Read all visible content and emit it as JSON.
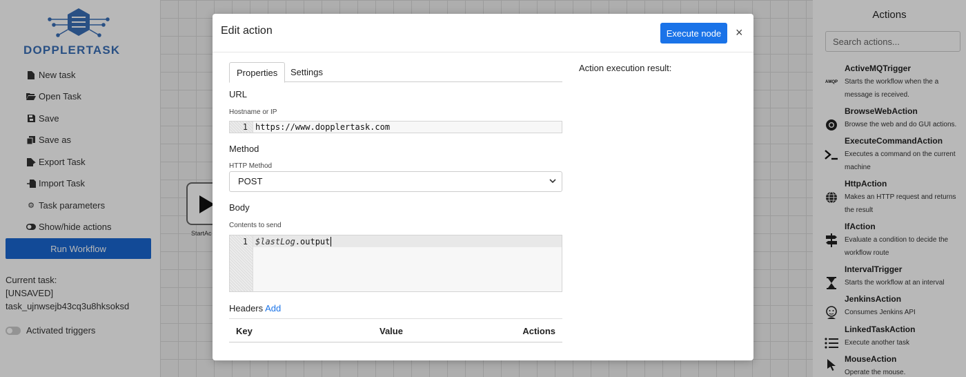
{
  "app": {
    "logo_text": "DOPPLERTASK",
    "accent_color": "#1a73e8"
  },
  "sidebar": {
    "items": [
      {
        "label": "New task",
        "icon": "file-icon"
      },
      {
        "label": "Open Task",
        "icon": "folder-open-icon"
      },
      {
        "label": "Save",
        "icon": "save-icon"
      },
      {
        "label": "Save as",
        "icon": "copy-icon"
      },
      {
        "label": "Export Task",
        "icon": "export-icon"
      },
      {
        "label": "Import Task",
        "icon": "import-icon"
      },
      {
        "label": "Task parameters",
        "icon": "gear-icon"
      },
      {
        "label": "Show/hide actions",
        "icon": "toggle-icon"
      }
    ],
    "run_label": "Run Workflow",
    "current_task": {
      "label": "Current task:",
      "status": "[UNSAVED]",
      "name": "task_ujnwsejb43cq3u8hksoksd"
    },
    "activated_triggers_label": "Activated triggers"
  },
  "canvas": {
    "start_node_label": "StartAc"
  },
  "actions_panel": {
    "title": "Actions",
    "search_placeholder": "Search actions...",
    "items": [
      {
        "name": "ActiveMQTrigger",
        "description": "Starts the workflow when the a message is received.",
        "icon": "amqp-icon",
        "icon_text": "AMQP"
      },
      {
        "name": "BrowseWebAction",
        "description": "Browse the web and do GUI actions.",
        "icon": "chrome-icon",
        "icon_text": ""
      },
      {
        "name": "ExecuteCommandAction",
        "description": "Executes a command on the current machine",
        "icon": "terminal-icon",
        "icon_text": ""
      },
      {
        "name": "HttpAction",
        "description": "Makes an HTTP request and returns the result",
        "icon": "globe-icon",
        "icon_text": ""
      },
      {
        "name": "IfAction",
        "description": "Evaluate a condition to decide the workflow route",
        "icon": "signpost-icon",
        "icon_text": ""
      },
      {
        "name": "IntervalTrigger",
        "description": "Starts the workflow at an interval",
        "icon": "hourglass-icon",
        "icon_text": ""
      },
      {
        "name": "JenkinsAction",
        "description": "Consumes Jenkins API",
        "icon": "jenkins-icon",
        "icon_text": ""
      },
      {
        "name": "LinkedTaskAction",
        "description": "Execute another task",
        "icon": "list-icon",
        "icon_text": ""
      },
      {
        "name": "MouseAction",
        "description": "Operate the mouse.",
        "icon": "cursor-icon",
        "icon_text": ""
      }
    ]
  },
  "modal": {
    "title": "Edit action",
    "execute_label": "Execute node",
    "close_label": "×",
    "tabs": [
      {
        "label": "Properties",
        "active": true
      },
      {
        "label": "Settings",
        "active": false
      }
    ],
    "url": {
      "heading": "URL",
      "label": "Hostname or IP",
      "line_no": "1",
      "value": "https://www.dopplertask.com"
    },
    "method": {
      "heading": "Method",
      "label": "HTTP Method",
      "value": "POST"
    },
    "body": {
      "heading": "Body",
      "label": "Contents to send",
      "line_no": "1",
      "value_prefix": "$lastLog",
      "value_suffix": ".output"
    },
    "headers": {
      "heading": "Headers",
      "add_label": "Add",
      "columns": [
        "Key",
        "Value",
        "Actions"
      ]
    },
    "result_label": "Action execution result:"
  }
}
